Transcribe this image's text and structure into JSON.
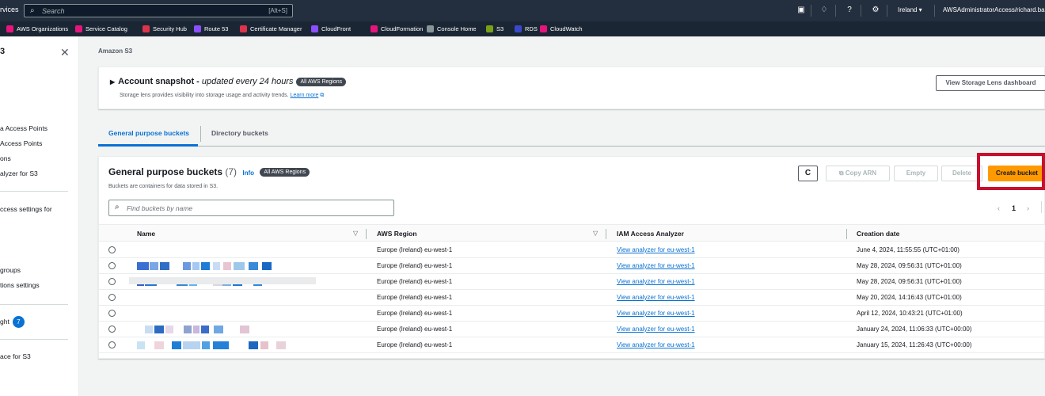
{
  "topnav": {
    "services_label": "rvices",
    "search_placeholder": "Search",
    "search_shortcut": "[Alt+S]",
    "region": "Ireland ▾",
    "account": "AWSAdministratorAccess/richard.baile"
  },
  "favorites": [
    {
      "label": "AWS Organizations",
      "color": "#e7157b"
    },
    {
      "label": "Service Catalog",
      "color": "#e7157b"
    },
    {
      "label": "Security Hub",
      "color": "#dd344c"
    },
    {
      "label": "Route 53",
      "color": "#8c4fff"
    },
    {
      "label": "Certificate Manager",
      "color": "#dd344c"
    },
    {
      "label": "CloudFront",
      "color": "#8c4fff"
    },
    {
      "label": "CloudFormation",
      "color": "#e7157b"
    },
    {
      "label": "Console Home",
      "color": "#879596"
    },
    {
      "label": "S3",
      "color": "#7aa116"
    },
    {
      "label": "RDS",
      "color": "#3b48cc"
    },
    {
      "label": "CloudWatch",
      "color": "#e7157b"
    }
  ],
  "sidebar": {
    "title": "3",
    "items": [
      "a Access Points",
      "Access Points",
      "ons",
      "alyzer for S3",
      "ccess settings for",
      "groups",
      "tions settings",
      "ght",
      "ace for S3"
    ],
    "badge": "7"
  },
  "breadcrumb": "Amazon S3",
  "snapshot": {
    "title": "Account snapshot - ",
    "title_italic": "updated every 24 hours",
    "pill": "All AWS Regions",
    "desc": "Storage lens provides visibility into storage usage and activity trends.",
    "learn_more": "Learn more",
    "button": "View Storage Lens dashboard"
  },
  "tabs": [
    "General purpose buckets",
    "Directory buckets"
  ],
  "buckets_panel": {
    "title": "General purpose buckets",
    "count": "(7)",
    "info": "Info",
    "pill": "All AWS Regions",
    "desc": "Buckets are containers for data stored in S3.",
    "search_placeholder": "Find buckets by name",
    "buttons": {
      "refresh": "C",
      "copy_arn": "Copy ARN",
      "empty": "Empty",
      "delete": "Delete",
      "create": "Create bucket"
    },
    "page": "1"
  },
  "table": {
    "headers": [
      "Name",
      "AWS Region",
      "IAM Access Analyzer",
      "Creation date"
    ],
    "rows": [
      {
        "region": "Europe (Ireland) eu-west-1",
        "analyzer": "View analyzer for eu-west-1",
        "date": "June 4, 2024, 11:55:55 (UTC+01:00)"
      },
      {
        "region": "Europe (Ireland) eu-west-1",
        "analyzer": "View analyzer for eu-west-1",
        "date": "May 28, 2024, 09:56:31 (UTC+01:00)"
      },
      {
        "region": "Europe (Ireland) eu-west-1",
        "analyzer": "View analyzer for eu-west-1",
        "date": "May 28, 2024, 09:56:31 (UTC+01:00)"
      },
      {
        "region": "Europe (Ireland) eu-west-1",
        "analyzer": "View analyzer for eu-west-1",
        "date": "May 20, 2024, 14:16:43 (UTC+01:00)"
      },
      {
        "region": "Europe (Ireland) eu-west-1",
        "analyzer": "View analyzer for eu-west-1",
        "date": "April 12, 2024, 10:43:21 (UTC+01:00)"
      },
      {
        "region": "Europe (Ireland) eu-west-1",
        "analyzer": "View analyzer for eu-west-1",
        "date": "January 24, 2024, 11:06:33 (UTC+00:00)"
      },
      {
        "region": "Europe (Ireland) eu-west-1",
        "analyzer": "View analyzer for eu-west-1",
        "date": "January 15, 2024, 11:26:43 (UTC+00:00)"
      }
    ]
  },
  "colors": {
    "accent": "#0972d3",
    "primary_button": "#ff9900",
    "highlight": "#c8102e",
    "topnav": "#232f3e"
  }
}
